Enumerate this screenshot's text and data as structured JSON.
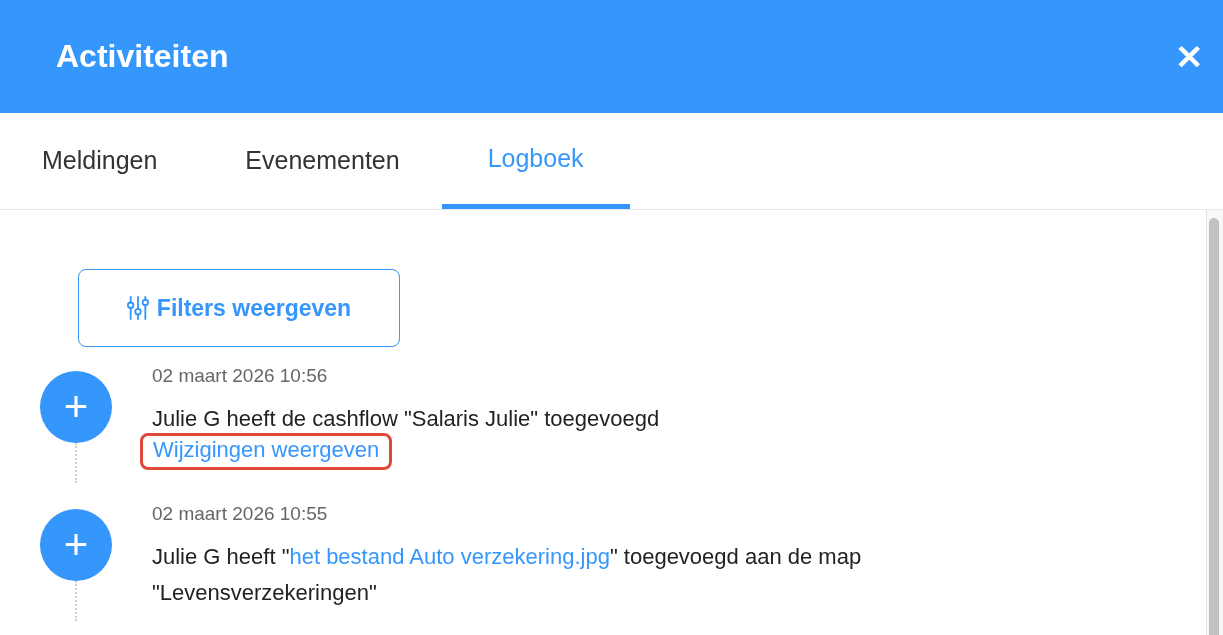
{
  "window": {
    "title": "Activiteiten",
    "close": "✕"
  },
  "tabs": [
    {
      "label": "Meldingen",
      "selected": false
    },
    {
      "label": "Evenementen",
      "selected": false
    },
    {
      "label": "Logboek",
      "selected": true
    }
  ],
  "filter_button": {
    "label": "Filters weergeven"
  },
  "entries": [
    {
      "time": "02 maart 2026 10:56",
      "icon": "+",
      "parts": [
        {
          "kind": "text",
          "text": "Julie G heeft de cashflow \"Salaris Julie\" toegevoegd"
        }
      ],
      "action": {
        "label": "Wijzigingen weergeven",
        "highlighted": true
      }
    },
    {
      "time": "02 maart 2026 10:55",
      "icon": "+",
      "parts": [
        {
          "kind": "text",
          "text": "Julie G heeft \""
        },
        {
          "kind": "link",
          "text": "het bestand Auto verzekering.jpg"
        },
        {
          "kind": "text",
          "text": "\" toegevoegd aan de map \"Levensverzekeringen\""
        }
      ]
    }
  ]
}
